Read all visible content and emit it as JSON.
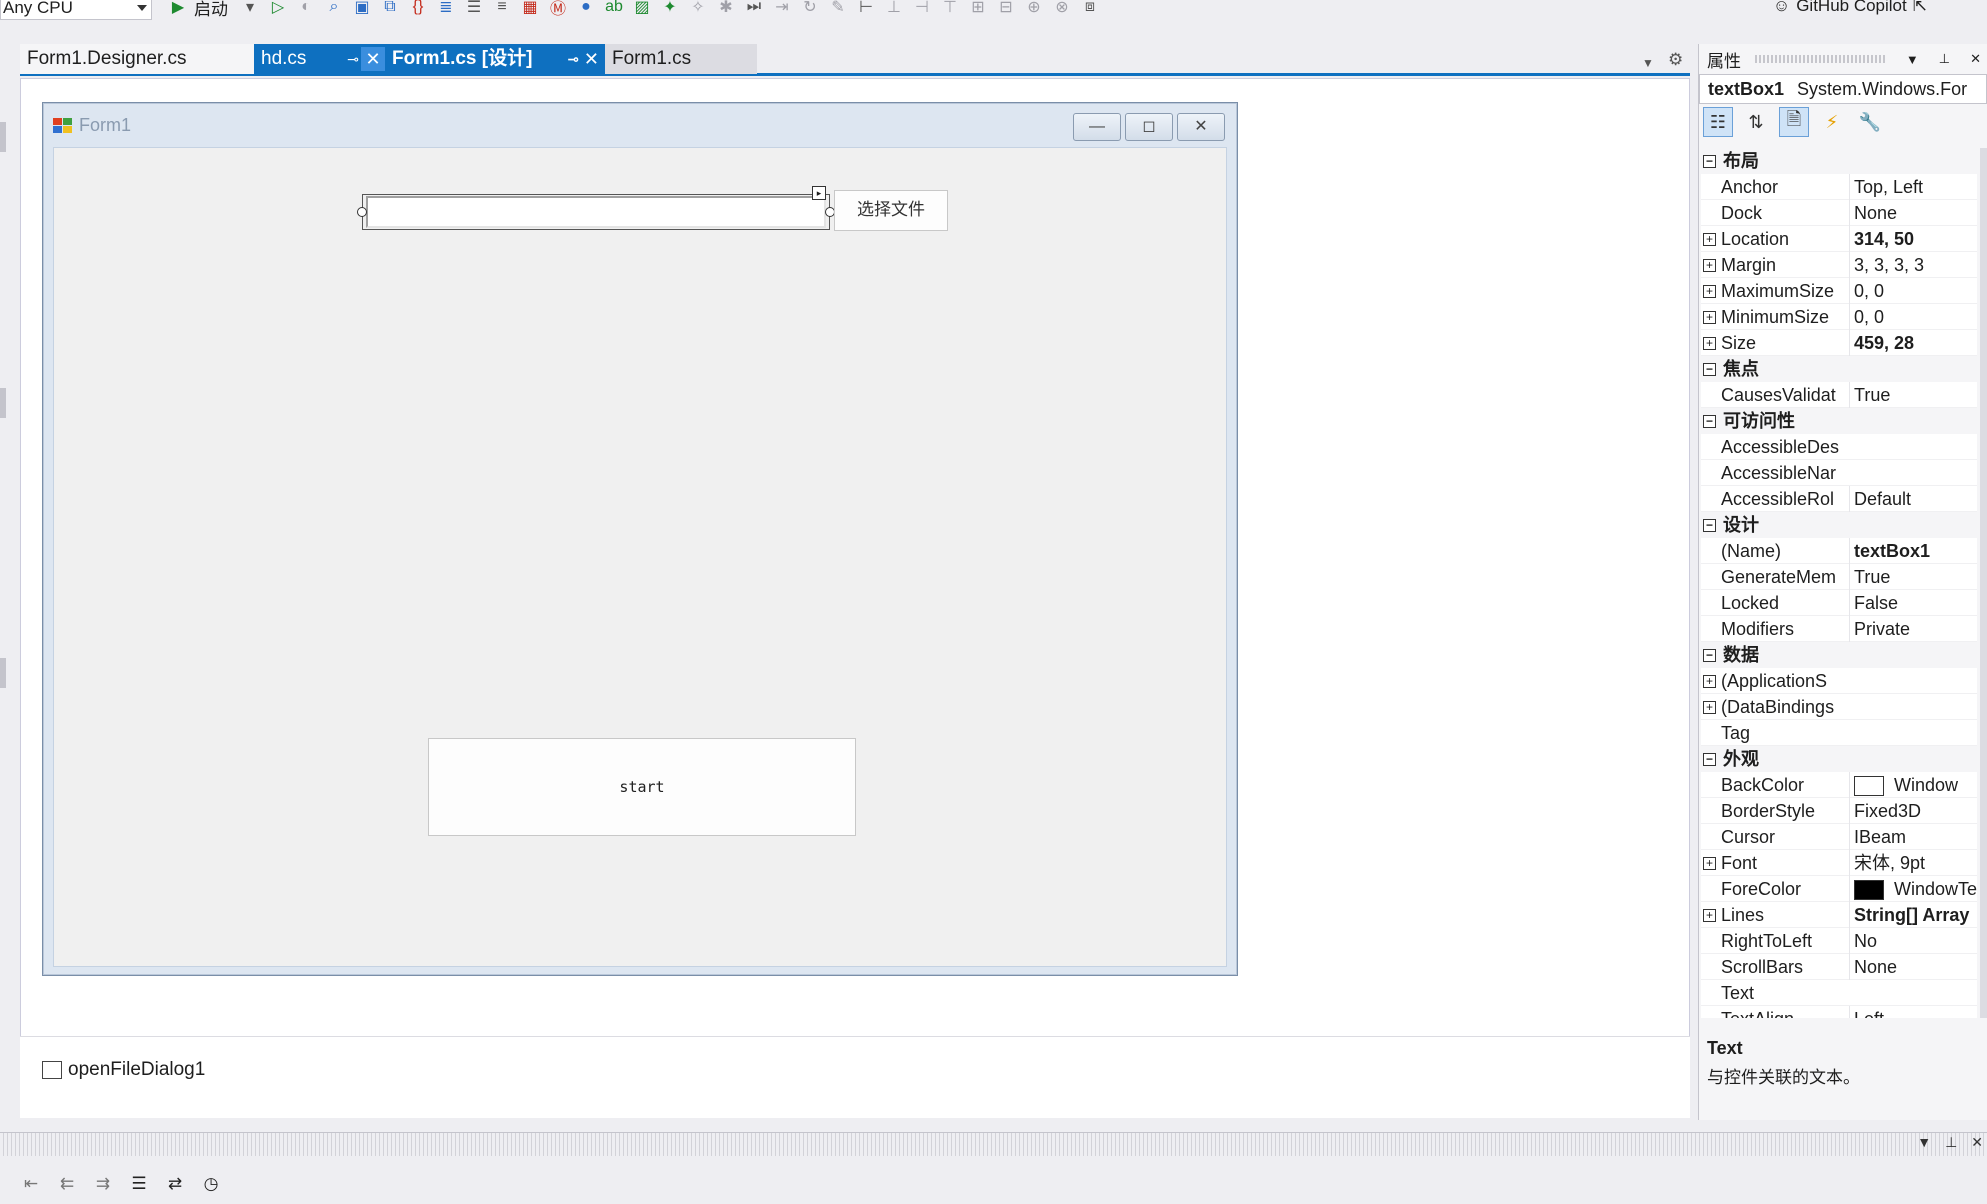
{
  "toolbar": {
    "platform": "Any CPU",
    "run_label": "启动",
    "copilot_label": "GitHub Copilot"
  },
  "tabs": [
    {
      "label": "Form1.Designer.cs"
    },
    {
      "label": "hd.cs"
    },
    {
      "label": "Form1.cs [设计]"
    },
    {
      "label": "Form1.cs"
    }
  ],
  "form": {
    "title": "Form1",
    "choose_button": "选择文件",
    "start_button": "start",
    "textbox_value": ""
  },
  "tray": {
    "component": "openFileDialog1"
  },
  "properties": {
    "panel_title": "属性",
    "object_name": "textBox1",
    "object_type": "System.Windows.For",
    "rows": [
      {
        "kind": "cat",
        "name": "布局"
      },
      {
        "kind": "prop",
        "name": "Anchor",
        "value": "Top, Left"
      },
      {
        "kind": "prop",
        "name": "Dock",
        "value": "None"
      },
      {
        "kind": "prop",
        "exp": true,
        "name": "Location",
        "value": "314, 50",
        "bold": true
      },
      {
        "kind": "prop",
        "exp": true,
        "name": "Margin",
        "value": "3, 3, 3, 3"
      },
      {
        "kind": "prop",
        "exp": true,
        "name": "MaximumSize",
        "value": "0, 0"
      },
      {
        "kind": "prop",
        "exp": true,
        "name": "MinimumSize",
        "value": "0, 0"
      },
      {
        "kind": "prop",
        "exp": true,
        "name": "Size",
        "value": "459, 28",
        "bold": true
      },
      {
        "kind": "cat",
        "name": "焦点"
      },
      {
        "kind": "prop",
        "name": "CausesValidat",
        "value": "True"
      },
      {
        "kind": "cat",
        "name": "可访问性"
      },
      {
        "kind": "prop",
        "name": "AccessibleDes",
        "value": ""
      },
      {
        "kind": "prop",
        "name": "AccessibleNar",
        "value": ""
      },
      {
        "kind": "prop",
        "name": "AccessibleRol",
        "value": "Default"
      },
      {
        "kind": "cat",
        "name": "设计"
      },
      {
        "kind": "prop",
        "name": "(Name)",
        "value": "textBox1",
        "bold": true
      },
      {
        "kind": "prop",
        "name": "GenerateMem",
        "value": "True"
      },
      {
        "kind": "prop",
        "name": "Locked",
        "value": "False"
      },
      {
        "kind": "prop",
        "name": "Modifiers",
        "value": "Private"
      },
      {
        "kind": "cat",
        "name": "数据"
      },
      {
        "kind": "prop",
        "exp": true,
        "name": "(ApplicationS",
        "value": ""
      },
      {
        "kind": "prop",
        "exp": true,
        "name": "(DataBindings",
        "value": ""
      },
      {
        "kind": "prop",
        "name": "Tag",
        "value": ""
      },
      {
        "kind": "cat",
        "name": "外观"
      },
      {
        "kind": "prop",
        "name": "BackColor",
        "value": "Window",
        "swatch": "#ffffff"
      },
      {
        "kind": "prop",
        "name": "BorderStyle",
        "value": "Fixed3D"
      },
      {
        "kind": "prop",
        "name": "Cursor",
        "value": "IBeam"
      },
      {
        "kind": "prop",
        "exp": true,
        "name": "Font",
        "value": "宋体, 9pt"
      },
      {
        "kind": "prop",
        "name": "ForeColor",
        "value": "WindowTe",
        "swatch": "#000000"
      },
      {
        "kind": "prop",
        "exp": true,
        "name": "Lines",
        "value": "String[] Array",
        "bold": true
      },
      {
        "kind": "prop",
        "name": "RightToLeft",
        "value": "No"
      },
      {
        "kind": "prop",
        "name": "ScrollBars",
        "value": "None"
      },
      {
        "kind": "prop",
        "name": "Text",
        "value": ""
      },
      {
        "kind": "prop",
        "name": "TextAlign",
        "value": "Left"
      }
    ],
    "desc_title": "Text",
    "desc_text": "与控件关联的文本。"
  },
  "colors": {
    "accent": "#0e70c0",
    "run_green": "#1e8a30"
  }
}
